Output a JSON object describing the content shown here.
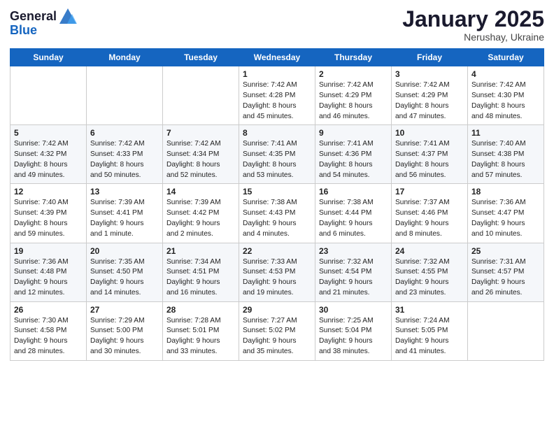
{
  "header": {
    "logo_general": "General",
    "logo_blue": "Blue",
    "month": "January 2025",
    "location": "Nerushay, Ukraine"
  },
  "weekdays": [
    "Sunday",
    "Monday",
    "Tuesday",
    "Wednesday",
    "Thursday",
    "Friday",
    "Saturday"
  ],
  "weeks": [
    [
      {
        "day": "",
        "info": ""
      },
      {
        "day": "",
        "info": ""
      },
      {
        "day": "",
        "info": ""
      },
      {
        "day": "1",
        "info": "Sunrise: 7:42 AM\nSunset: 4:28 PM\nDaylight: 8 hours\nand 45 minutes."
      },
      {
        "day": "2",
        "info": "Sunrise: 7:42 AM\nSunset: 4:29 PM\nDaylight: 8 hours\nand 46 minutes."
      },
      {
        "day": "3",
        "info": "Sunrise: 7:42 AM\nSunset: 4:29 PM\nDaylight: 8 hours\nand 47 minutes."
      },
      {
        "day": "4",
        "info": "Sunrise: 7:42 AM\nSunset: 4:30 PM\nDaylight: 8 hours\nand 48 minutes."
      }
    ],
    [
      {
        "day": "5",
        "info": "Sunrise: 7:42 AM\nSunset: 4:32 PM\nDaylight: 8 hours\nand 49 minutes."
      },
      {
        "day": "6",
        "info": "Sunrise: 7:42 AM\nSunset: 4:33 PM\nDaylight: 8 hours\nand 50 minutes."
      },
      {
        "day": "7",
        "info": "Sunrise: 7:42 AM\nSunset: 4:34 PM\nDaylight: 8 hours\nand 52 minutes."
      },
      {
        "day": "8",
        "info": "Sunrise: 7:41 AM\nSunset: 4:35 PM\nDaylight: 8 hours\nand 53 minutes."
      },
      {
        "day": "9",
        "info": "Sunrise: 7:41 AM\nSunset: 4:36 PM\nDaylight: 8 hours\nand 54 minutes."
      },
      {
        "day": "10",
        "info": "Sunrise: 7:41 AM\nSunset: 4:37 PM\nDaylight: 8 hours\nand 56 minutes."
      },
      {
        "day": "11",
        "info": "Sunrise: 7:40 AM\nSunset: 4:38 PM\nDaylight: 8 hours\nand 57 minutes."
      }
    ],
    [
      {
        "day": "12",
        "info": "Sunrise: 7:40 AM\nSunset: 4:39 PM\nDaylight: 8 hours\nand 59 minutes."
      },
      {
        "day": "13",
        "info": "Sunrise: 7:39 AM\nSunset: 4:41 PM\nDaylight: 9 hours\nand 1 minute."
      },
      {
        "day": "14",
        "info": "Sunrise: 7:39 AM\nSunset: 4:42 PM\nDaylight: 9 hours\nand 2 minutes."
      },
      {
        "day": "15",
        "info": "Sunrise: 7:38 AM\nSunset: 4:43 PM\nDaylight: 9 hours\nand 4 minutes."
      },
      {
        "day": "16",
        "info": "Sunrise: 7:38 AM\nSunset: 4:44 PM\nDaylight: 9 hours\nand 6 minutes."
      },
      {
        "day": "17",
        "info": "Sunrise: 7:37 AM\nSunset: 4:46 PM\nDaylight: 9 hours\nand 8 minutes."
      },
      {
        "day": "18",
        "info": "Sunrise: 7:36 AM\nSunset: 4:47 PM\nDaylight: 9 hours\nand 10 minutes."
      }
    ],
    [
      {
        "day": "19",
        "info": "Sunrise: 7:36 AM\nSunset: 4:48 PM\nDaylight: 9 hours\nand 12 minutes."
      },
      {
        "day": "20",
        "info": "Sunrise: 7:35 AM\nSunset: 4:50 PM\nDaylight: 9 hours\nand 14 minutes."
      },
      {
        "day": "21",
        "info": "Sunrise: 7:34 AM\nSunset: 4:51 PM\nDaylight: 9 hours\nand 16 minutes."
      },
      {
        "day": "22",
        "info": "Sunrise: 7:33 AM\nSunset: 4:53 PM\nDaylight: 9 hours\nand 19 minutes."
      },
      {
        "day": "23",
        "info": "Sunrise: 7:32 AM\nSunset: 4:54 PM\nDaylight: 9 hours\nand 21 minutes."
      },
      {
        "day": "24",
        "info": "Sunrise: 7:32 AM\nSunset: 4:55 PM\nDaylight: 9 hours\nand 23 minutes."
      },
      {
        "day": "25",
        "info": "Sunrise: 7:31 AM\nSunset: 4:57 PM\nDaylight: 9 hours\nand 26 minutes."
      }
    ],
    [
      {
        "day": "26",
        "info": "Sunrise: 7:30 AM\nSunset: 4:58 PM\nDaylight: 9 hours\nand 28 minutes."
      },
      {
        "day": "27",
        "info": "Sunrise: 7:29 AM\nSunset: 5:00 PM\nDaylight: 9 hours\nand 30 minutes."
      },
      {
        "day": "28",
        "info": "Sunrise: 7:28 AM\nSunset: 5:01 PM\nDaylight: 9 hours\nand 33 minutes."
      },
      {
        "day": "29",
        "info": "Sunrise: 7:27 AM\nSunset: 5:02 PM\nDaylight: 9 hours\nand 35 minutes."
      },
      {
        "day": "30",
        "info": "Sunrise: 7:25 AM\nSunset: 5:04 PM\nDaylight: 9 hours\nand 38 minutes."
      },
      {
        "day": "31",
        "info": "Sunrise: 7:24 AM\nSunset: 5:05 PM\nDaylight: 9 hours\nand 41 minutes."
      },
      {
        "day": "",
        "info": ""
      }
    ]
  ]
}
